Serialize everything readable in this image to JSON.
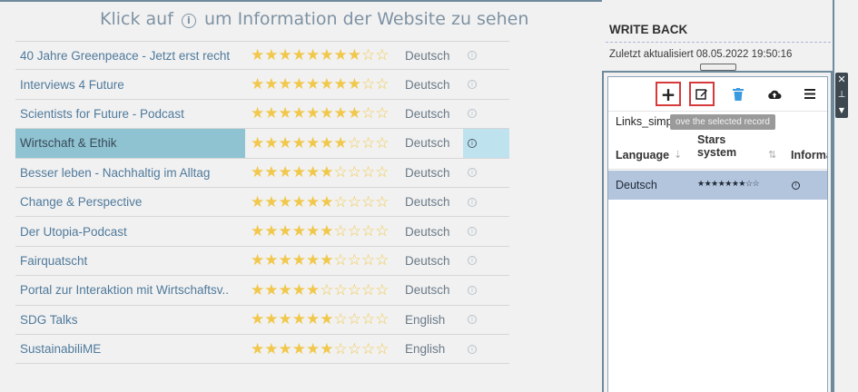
{
  "heading": {
    "before": "Klick auf",
    "icon": "info-icon",
    "after": "um Information der Website zu sehen"
  },
  "rows": [
    {
      "title": "40 Jahre Greenpeace - Jetzt erst recht",
      "stars_filled": 8,
      "stars_total": 10,
      "language": "Deutsch",
      "selected": false
    },
    {
      "title": "Interviews 4 Future",
      "stars_filled": 8,
      "stars_total": 10,
      "language": "Deutsch",
      "selected": false
    },
    {
      "title": "Scientists for Future - Podcast",
      "stars_filled": 8,
      "stars_total": 10,
      "language": "Deutsch",
      "selected": false
    },
    {
      "title": "Wirtschaft & Ethik",
      "stars_filled": 7,
      "stars_total": 10,
      "language": "Deutsch",
      "selected": true
    },
    {
      "title": "Besser leben - Nachhaltig im Alltag",
      "stars_filled": 6,
      "stars_total": 10,
      "language": "Deutsch",
      "selected": false
    },
    {
      "title": "Change & Perspective",
      "stars_filled": 6,
      "stars_total": 10,
      "language": "Deutsch",
      "selected": false
    },
    {
      "title": "Der Utopia-Podcast",
      "stars_filled": 6,
      "stars_total": 10,
      "language": "Deutsch",
      "selected": false
    },
    {
      "title": "Fairquatscht",
      "stars_filled": 6,
      "stars_total": 10,
      "language": "Deutsch",
      "selected": false
    },
    {
      "title": "Portal zur Interaktion mit Wirtschaftsv..",
      "stars_filled": 5,
      "stars_total": 10,
      "language": "Deutsch",
      "selected": false
    },
    {
      "title": "SDG Talks",
      "stars_filled": 6,
      "stars_total": 10,
      "language": "English",
      "selected": false
    },
    {
      "title": "SustainabiliME",
      "stars_filled": 6,
      "stars_total": 10,
      "language": "English",
      "selected": false
    }
  ],
  "writeback": {
    "title": "WRITE BACK",
    "updated": "Zuletzt aktualisiert 08.05.2022 19:50:16",
    "table_name": "Links_simplified",
    "tooltip": "ove the selected record",
    "toolbar": {
      "add_icon": "plus-icon",
      "edit_icon": "edit-icon",
      "delete_icon": "trash-icon",
      "upload_icon": "cloud-upload-icon",
      "menu_icon": "menu-icon"
    },
    "columns": {
      "language": "Language",
      "stars": "Stars system",
      "info": "Informa"
    },
    "record": {
      "language": "Deutsch",
      "stars": "★★★★★★★☆☆",
      "info_icon": "info-icon"
    }
  },
  "side_controls": {
    "close_icon": "close-icon",
    "pin_icon": "pin-icon",
    "more_icon": "caret-down-icon"
  },
  "colors": {
    "accent": "#8fc3d2",
    "star": "#f1c84b",
    "selected_record": "#b3c4dd",
    "highlight_box": "#d63a3a"
  }
}
